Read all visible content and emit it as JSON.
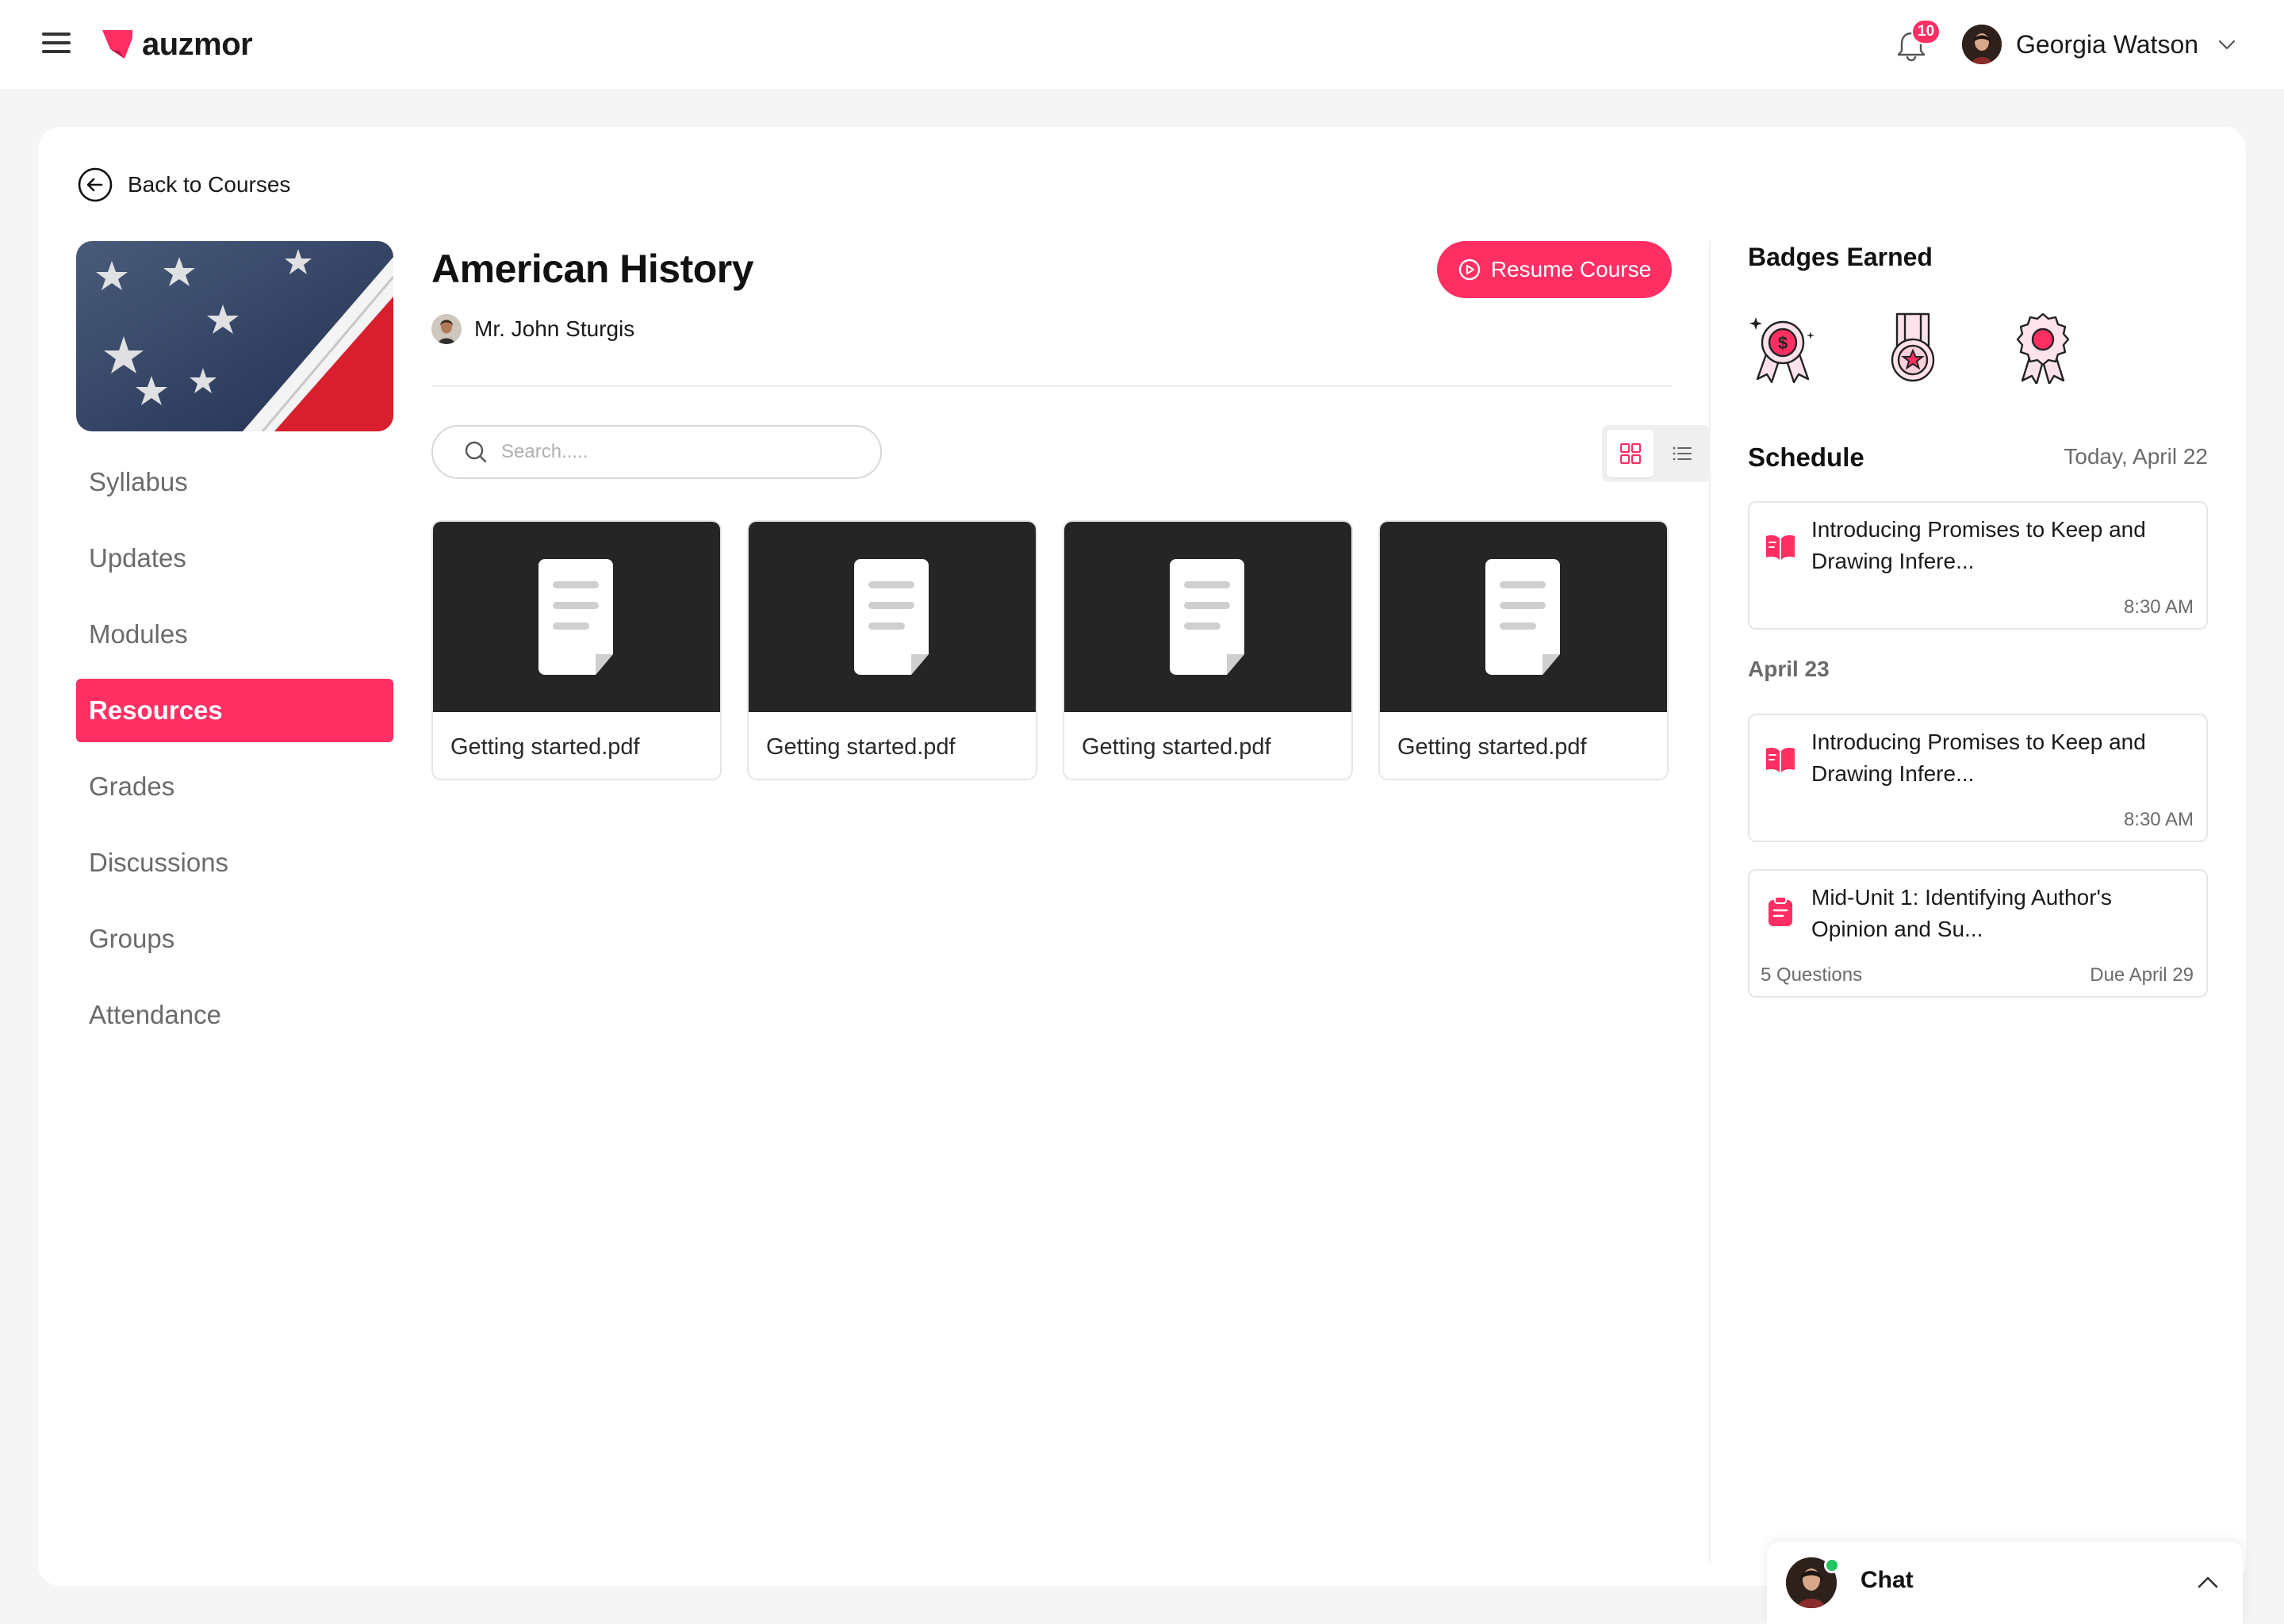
{
  "app": {
    "brand": "auzmor",
    "accent_color": "#ff2e63",
    "notifications_count": "10",
    "user_name": "Georgia Watson"
  },
  "back": {
    "label": "Back to Courses"
  },
  "nav": {
    "items": [
      {
        "label": "Syllabus",
        "active": false
      },
      {
        "label": "Updates",
        "active": false
      },
      {
        "label": "Modules",
        "active": false
      },
      {
        "label": "Resources",
        "active": true
      },
      {
        "label": "Grades",
        "active": false
      },
      {
        "label": "Discussions",
        "active": false
      },
      {
        "label": "Groups",
        "active": false
      },
      {
        "label": "Attendance",
        "active": false
      }
    ]
  },
  "course": {
    "title": "American History",
    "instructor": "Mr. John Sturgis",
    "resume_label": "Resume Course"
  },
  "search": {
    "placeholder": "Search....."
  },
  "view_mode": "grid",
  "files": [
    {
      "name": "Getting started.pdf"
    },
    {
      "name": "Getting started.pdf"
    },
    {
      "name": "Getting started.pdf"
    },
    {
      "name": "Getting started.pdf"
    }
  ],
  "badges": {
    "title": "Badges Earned",
    "items": [
      "dollar-ribbon-badge-icon",
      "star-medal-badge-icon",
      "rosette-badge-icon"
    ]
  },
  "schedule": {
    "title": "Schedule",
    "today_label": "Today, April 22",
    "groups": [
      {
        "date": "",
        "items": [
          {
            "type": "book",
            "title": "Introducing Promises to Keep and Drawing Infere...",
            "time": "8:30 AM"
          }
        ]
      },
      {
        "date": "April 23",
        "items": [
          {
            "type": "book",
            "title": "Introducing Promises to Keep and Drawing Infere...",
            "time": "8:30 AM"
          },
          {
            "type": "quiz",
            "title": "Mid-Unit 1: Identifying Author's Opinion and Su...",
            "questions": "5 Questions",
            "due": "Due April 29"
          }
        ]
      }
    ]
  },
  "chat": {
    "label": "Chat"
  }
}
